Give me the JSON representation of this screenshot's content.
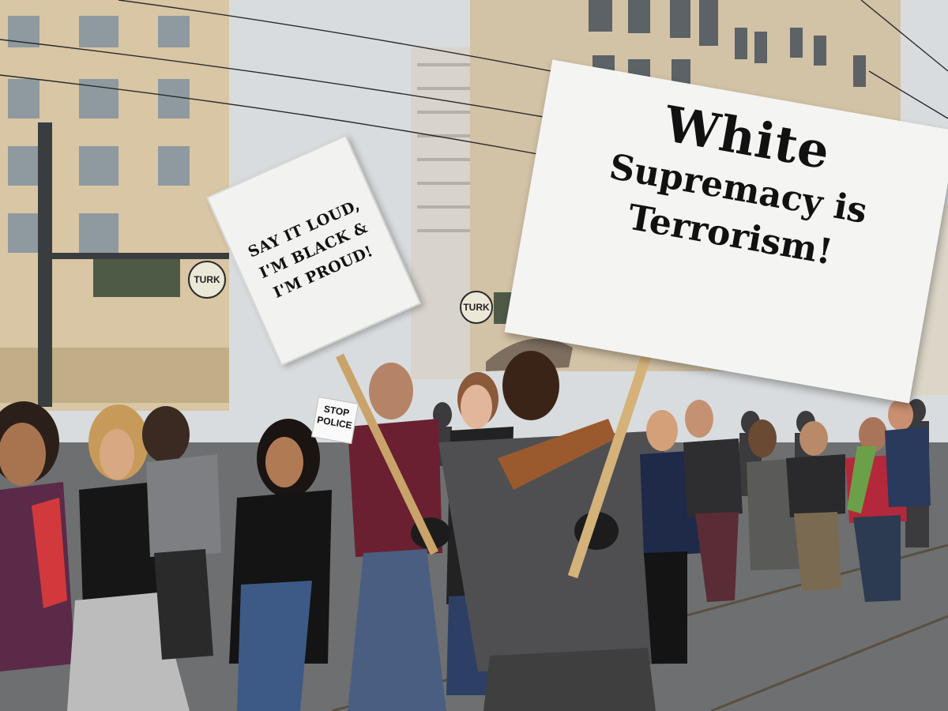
{
  "scene": {
    "street_signs": {
      "left": "TURK",
      "right": "TURK"
    },
    "protest_signs": {
      "handwritten": {
        "lines": [
          "SAY IT LOUD,",
          "I'M BLACK &",
          "I'M PROUD!"
        ]
      },
      "main": {
        "line1": "White",
        "line2": "Supremacy is",
        "line3": "Terrorism!"
      },
      "small": {
        "line1": "STOP",
        "line2": "POLICE"
      }
    }
  }
}
